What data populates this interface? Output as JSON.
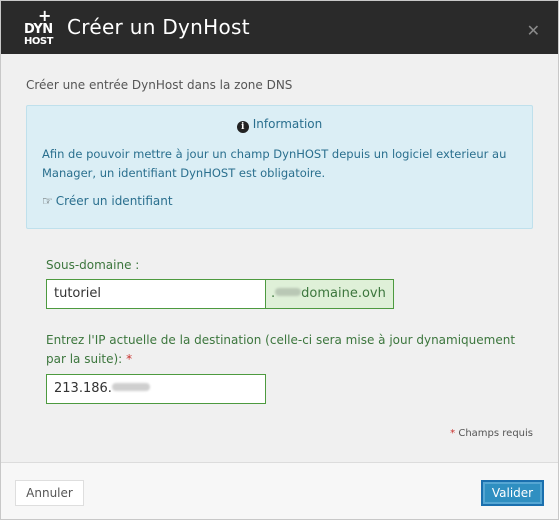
{
  "header": {
    "logo_dyn": "DYN",
    "logo_host": "HOST",
    "logo_plus": "+",
    "title": "Créer un DynHost",
    "close_icon": "close-icon"
  },
  "subtitle": "Créer une entrée DynHost dans la zone DNS",
  "info": {
    "icon": "info-circle-icon",
    "title": "Information",
    "text": "Afin de pouvoir mettre à jour un champ DynHOST depuis un logiciel exterieur au Manager, un identifiant DynHOST est obligatoire.",
    "link_icon": "hand-pointer-icon",
    "link_label": "Créer un identifiant"
  },
  "form": {
    "subdomain_label": "Sous-domaine :",
    "subdomain_value": "tutoriel",
    "domain_prefix": ".",
    "domain_suffix": "domaine.ovh",
    "ip_label": "Entrez l'IP actuelle de la destination (celle-ci sera mise à jour dynamiquement par la suite):",
    "required_mark": "*",
    "ip_value": "213.186.",
    "required_note_mark": "*",
    "required_note": "Champs requis"
  },
  "footer": {
    "cancel_label": "Annuler",
    "submit_label": "Valider"
  },
  "colors": {
    "header_bg": "#2a2a2a",
    "info_bg": "#dbeef5",
    "success_green": "#3c763d",
    "primary_blue": "#2f8fc1"
  }
}
